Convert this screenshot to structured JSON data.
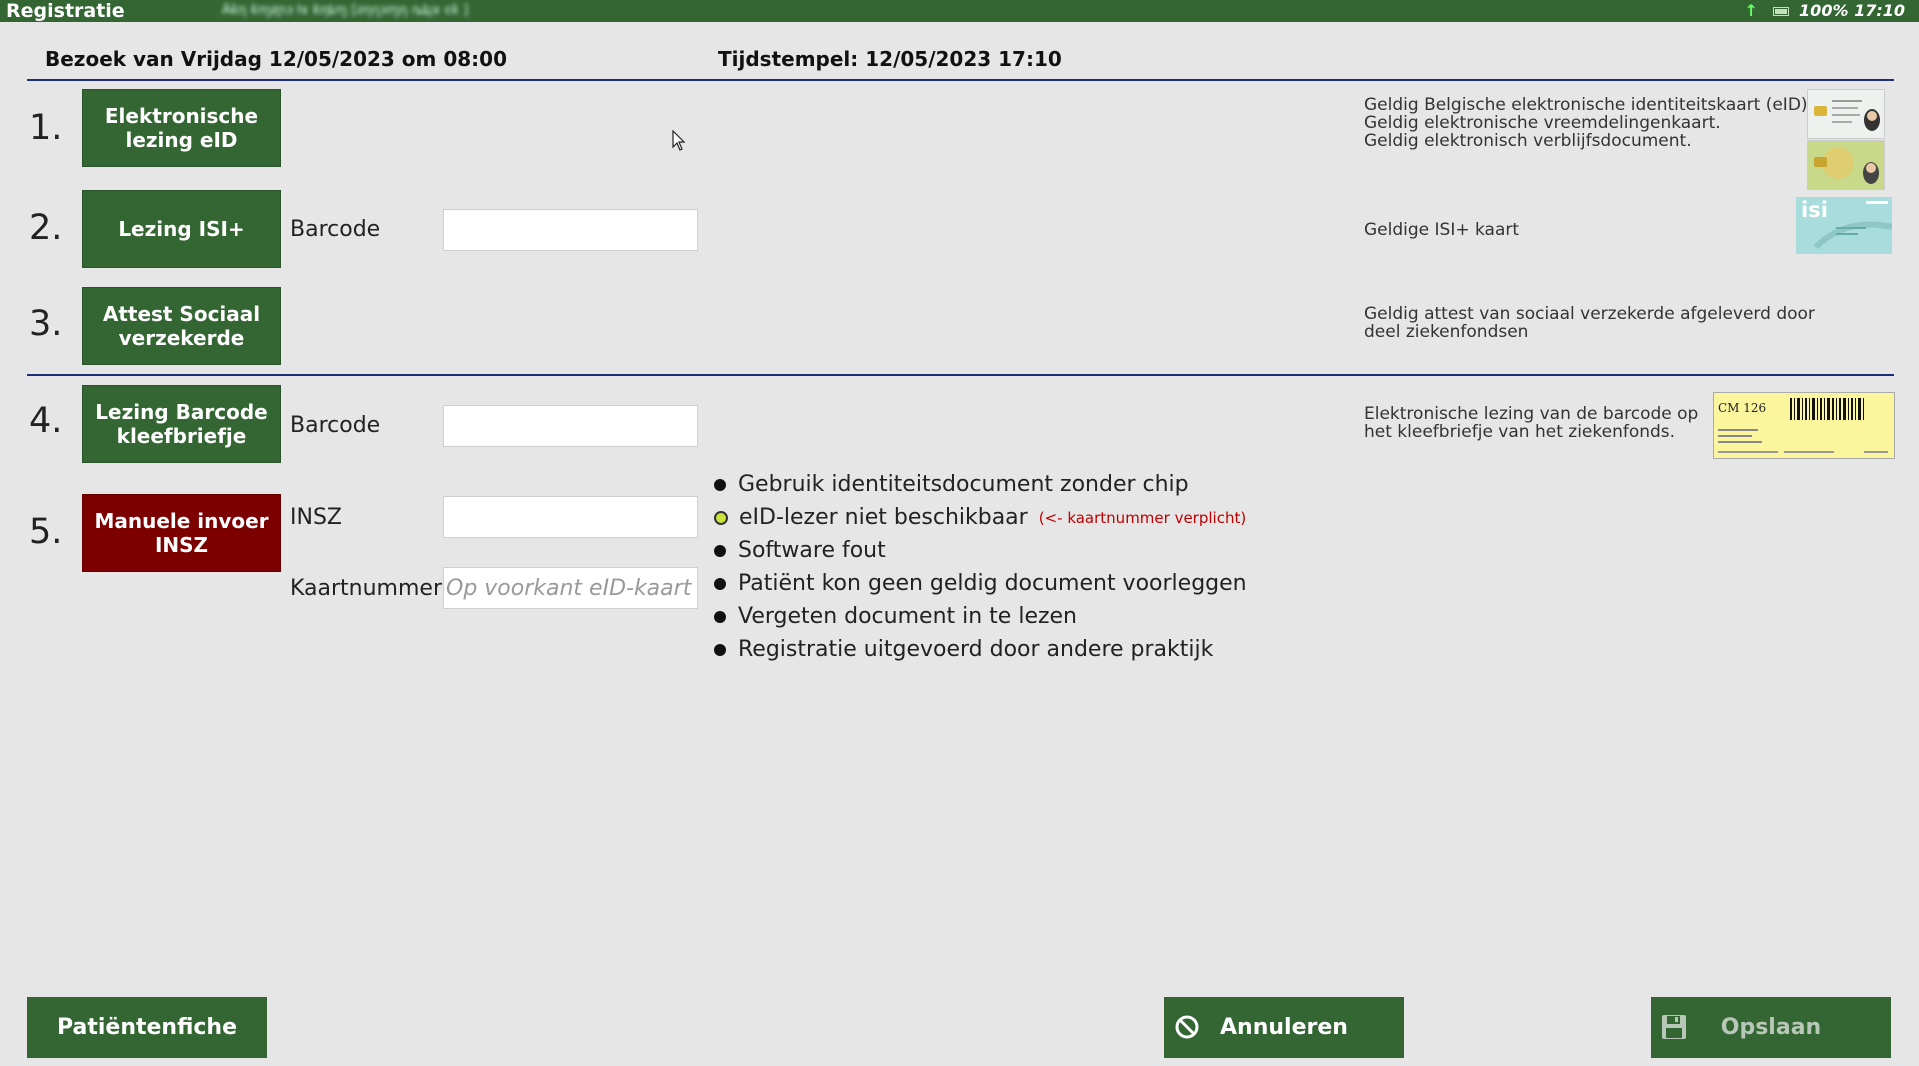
{
  "window": {
    "title": "Registratie",
    "blurred_caption": "Ȧƙƞ ƙɱƶɲɜ ƚɤ ƙƞȶɱ [ƨƞɳɜɱƞ ȵȶȷɤ ɛƙ ]",
    "status": {
      "battery": "100%",
      "time": "17:10"
    }
  },
  "header": {
    "visit": "Bezoek van Vrijdag 12/05/2023 om 08:00",
    "timestamp": "Tijdstempel: 12/05/2023 17:10"
  },
  "steps": [
    {
      "num": "1.",
      "label": "Elektronische lezing eID",
      "desc": [
        "Geldig Belgische elektronische identiteitskaart (eID).",
        "Geldig elektronische vreemdelingenkaart.",
        "Geldig elektronisch verblijfsdocument."
      ]
    },
    {
      "num": "2.",
      "label": "Lezing ISI+",
      "field_label": "Barcode",
      "field_value": "",
      "desc": [
        "Geldige ISI+ kaart"
      ]
    },
    {
      "num": "3.",
      "label": "Attest Sociaal verzekerde",
      "desc": [
        "Geldig attest van sociaal verzekerde afgeleverd door",
        "deel ziekenfondsen"
      ]
    },
    {
      "num": "4.",
      "label": "Lezing Barcode kleefbriefje",
      "field_label": "Barcode",
      "field_value": "",
      "desc": [
        "Elektronische lezing van de barcode op",
        "het kleefbriefje van het ziekenfonds."
      ]
    },
    {
      "num": "5.",
      "label": "Manuele invoer INSZ",
      "field_label": "INSZ",
      "field_value": "",
      "field2_label": "Kaartnummer",
      "field2_placeholder": "Op voorkant eID-kaart ("
    }
  ],
  "reasons": [
    {
      "label": "Gebruik identiteitsdocument zonder chip",
      "selected": false
    },
    {
      "label": "eID-lezer niet beschikbaar",
      "selected": true,
      "hint": "(<- kaartnummer verplicht)"
    },
    {
      "label": "Software fout",
      "selected": false
    },
    {
      "label": "Patiënt kon geen geldig document voorleggen",
      "selected": false
    },
    {
      "label": "Vergeten document in te lezen",
      "selected": false
    },
    {
      "label": "Registratie uitgevoerd door andere praktijk",
      "selected": false
    }
  ],
  "isi_logo": "isi",
  "sticker_text": "CM 126",
  "footer": {
    "patient": "Patiëntenfiche",
    "cancel": "Annuleren",
    "save": "Opslaan"
  },
  "colors": {
    "primary": "#336633",
    "danger": "#7d0000",
    "rule": "#1e2d7a",
    "hint": "#c00000",
    "selected_radio": "#cbe33a"
  },
  "icons": {
    "cancel": "no-entry-icon",
    "save": "floppy-disk-icon"
  }
}
